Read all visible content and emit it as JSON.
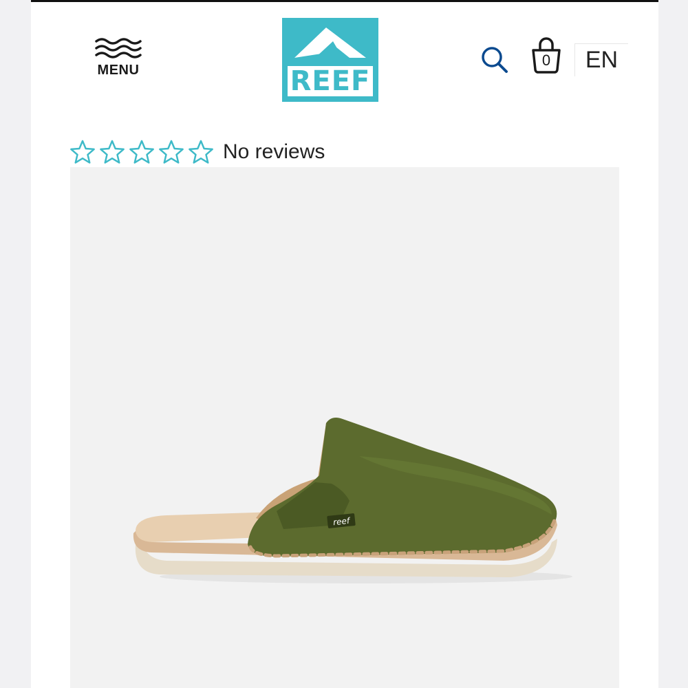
{
  "header": {
    "menu_label": "MENU",
    "logo_text": "REEF",
    "cart_count": "0",
    "language": "EN"
  },
  "product": {
    "rating": {
      "stars_filled": 0,
      "stars_total": 5,
      "reviews_text": "No reviews"
    },
    "shoe_tag": "reef"
  },
  "colors": {
    "brand_teal": "#3ebac8",
    "search_icon": "#0b4a8f",
    "shoe_upper": "#5c6b2e",
    "sole": "#e9d6bd"
  },
  "icons": [
    "menu-waves-icon",
    "reef-logo",
    "search-icon",
    "shopping-bag-icon",
    "star-outline-icon"
  ]
}
